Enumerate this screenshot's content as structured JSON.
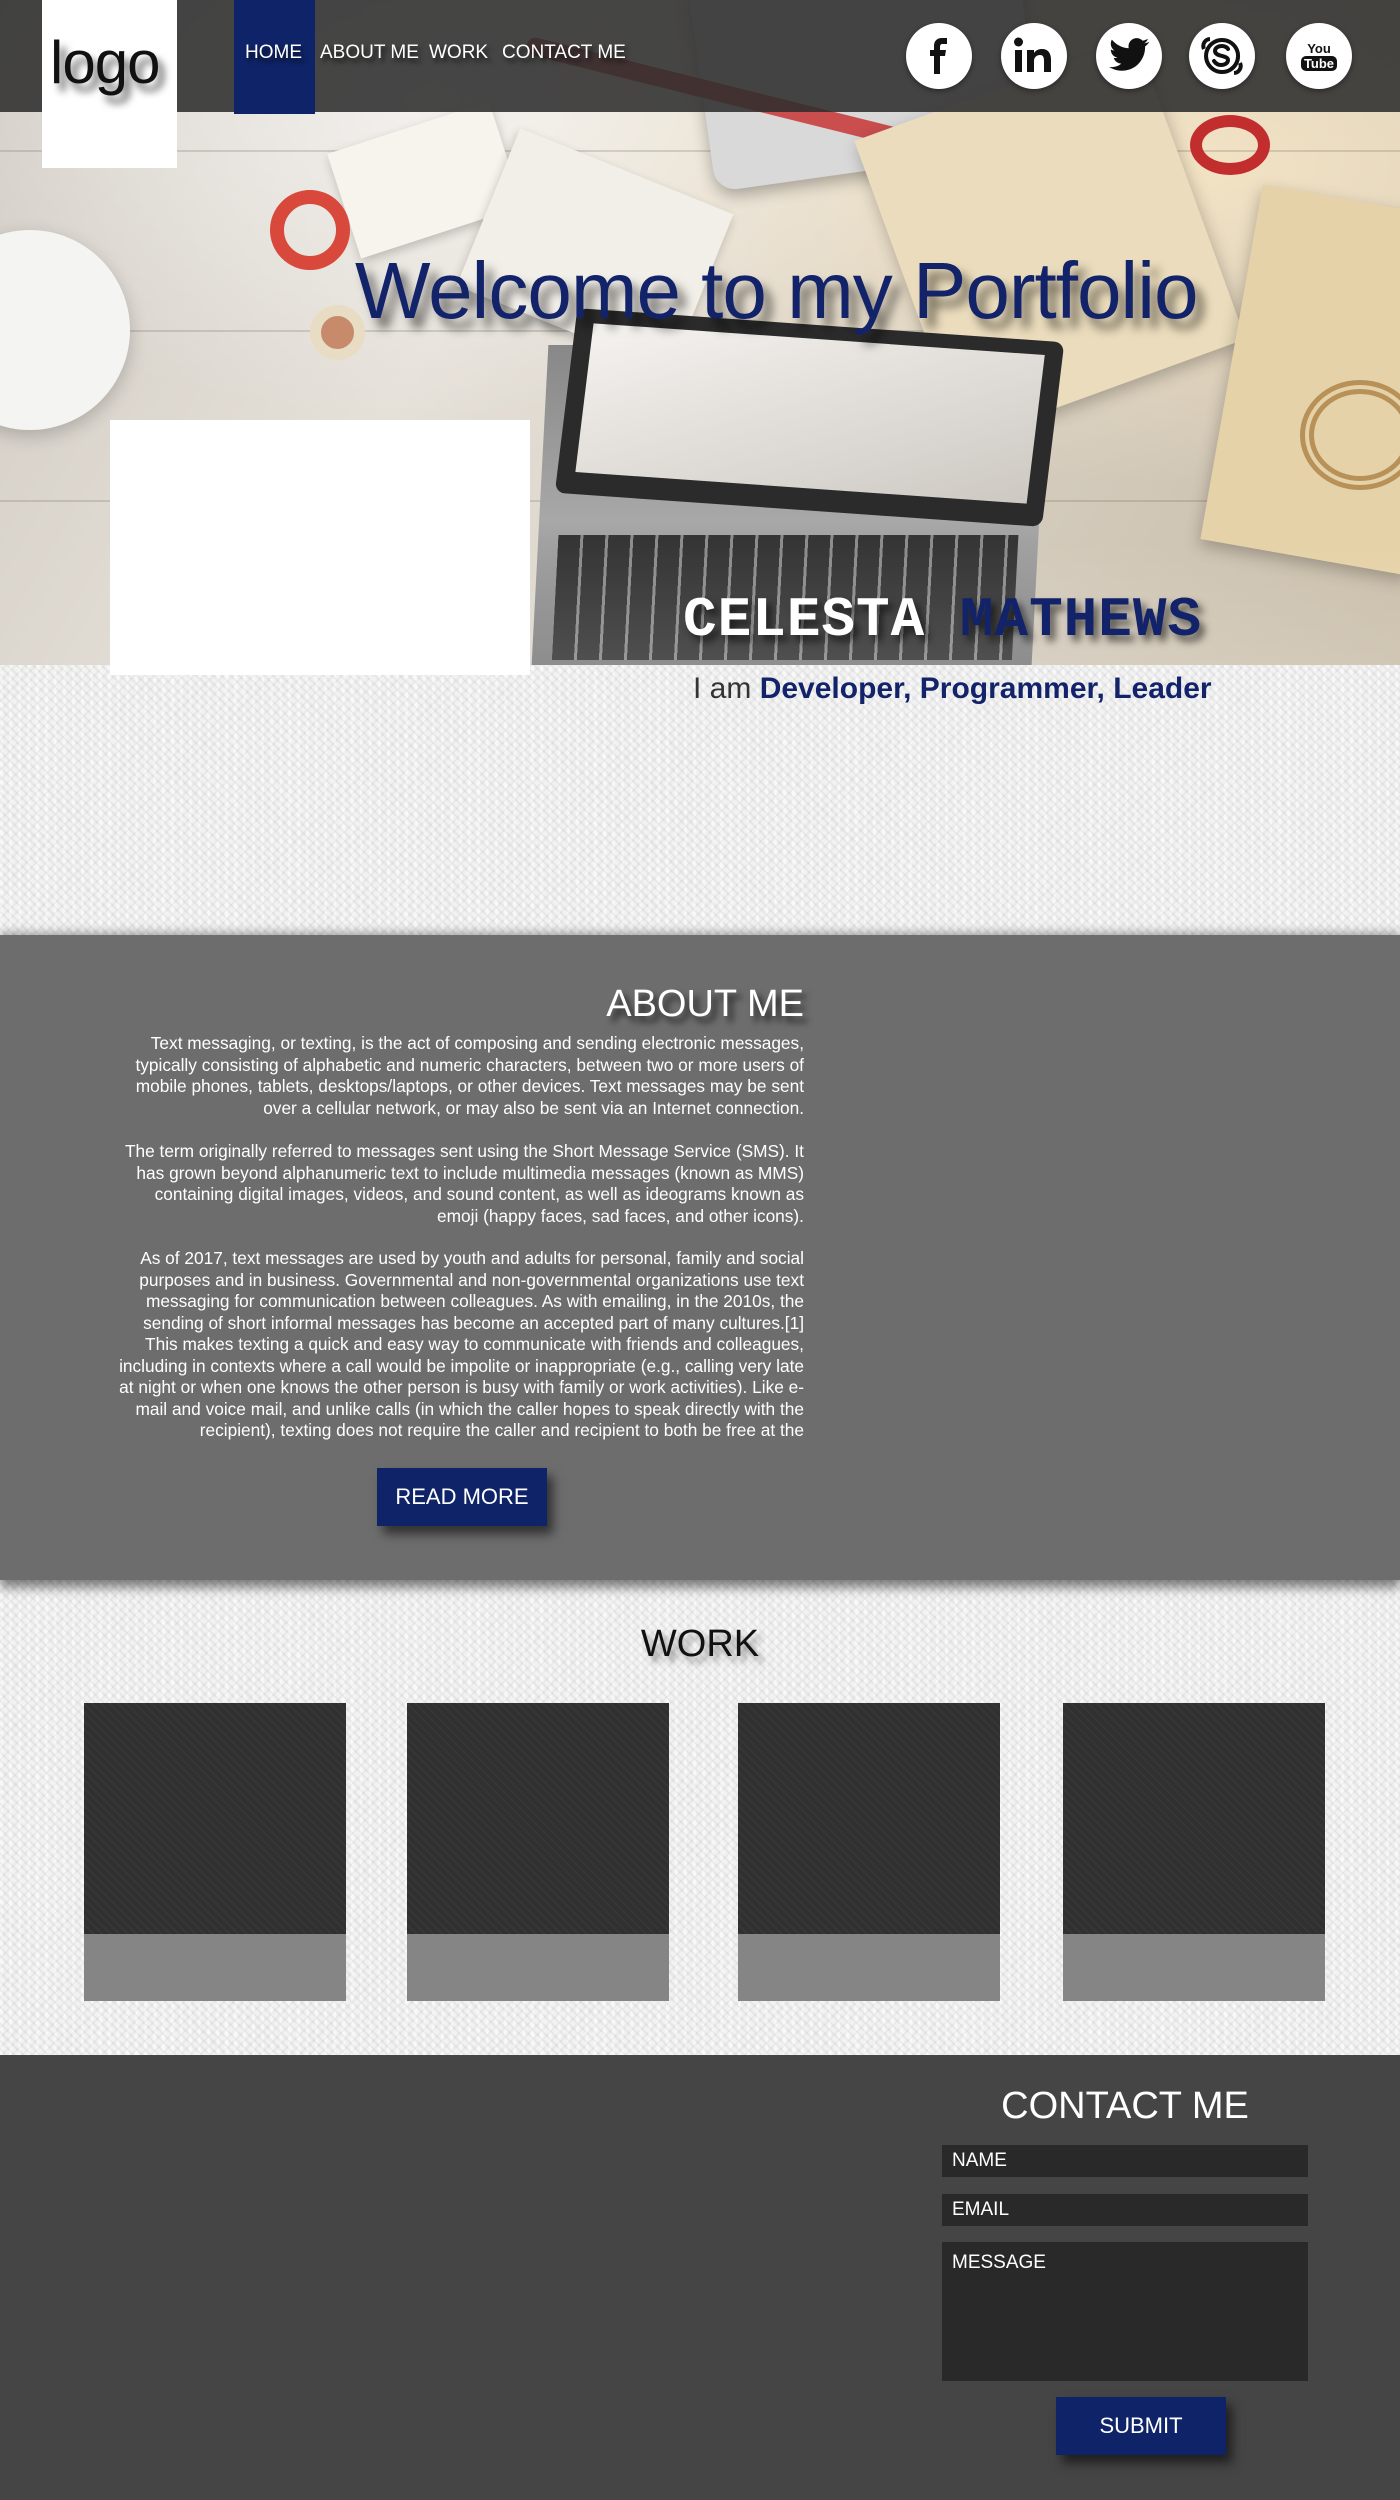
{
  "logo": {
    "text": "logo"
  },
  "nav": {
    "items": [
      {
        "label": "HOME",
        "active": true
      },
      {
        "label": "ABOUT ME"
      },
      {
        "label": "WORK"
      },
      {
        "label": "CONTACT ME"
      }
    ],
    "active_color": "#0f2468"
  },
  "social": [
    "facebook-icon",
    "linkedin-icon",
    "twitter-icon",
    "skype-icon",
    "youtube-icon"
  ],
  "social_text": {
    "youtube_top": "You",
    "youtube_bottom": "Tube"
  },
  "hero": {
    "welcome": "Welcome to my Portfolio",
    "first_name": "CELESTA",
    "last_name": "MATHEWS",
    "tagline_prefix": "I am",
    "tagline_roles": "Developer, Programmer, Leader"
  },
  "about": {
    "title": "ABOUT ME",
    "paragraphs": [
      "Text messaging, or texting, is the act of composing and sending electronic messages, typically consisting of alphabetic and numeric characters, between two or more users of mobile phones, tablets, desktops/laptops, or other devices. Text messages may be sent over a cellular network, or may also be sent via an Internet connection.",
      "The term originally referred to messages sent using the Short Message Service (SMS). It has grown beyond alphanumeric text to include multimedia messages (known as MMS) containing digital images, videos, and sound content, as well as ideograms known as emoji (happy faces, sad faces, and other icons).",
      "As of 2017, text messages are used by youth and adults for personal, family and social purposes and in business. Governmental and non-governmental organizations use text messaging for communication between colleagues. As with emailing, in the 2010s, the sending of short informal messages has become an accepted part of many cultures.[1] This makes texting a quick and easy way to communicate with friends and colleagues, including in contexts where a call would be impolite or inappropriate (e.g., calling very late at night or when one knows the other person is busy with family or work activities). Like e-mail and voice mail, and unlike calls (in which the caller hopes to speak directly with the recipient), texting does not require the caller and recipient to both be free at the"
    ],
    "button": "READ MORE"
  },
  "work": {
    "title": "WORK"
  },
  "contact": {
    "title": "CONTACT ME",
    "name_placeholder": "NAME",
    "email_placeholder": "EMAIL",
    "message_placeholder": "MESSAGE",
    "button": "SUBMIT"
  }
}
